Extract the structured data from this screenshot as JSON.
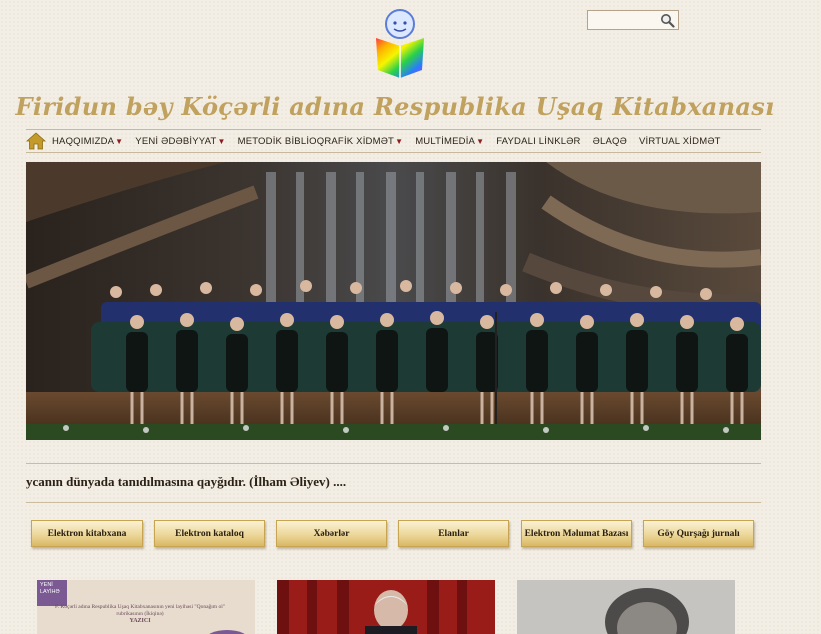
{
  "header": {
    "site_title": "Firidun bəy Köçərli adına Respublika Uşaq Kitabxanası"
  },
  "search": {
    "placeholder": "",
    "value": ""
  },
  "nav": {
    "items": [
      {
        "label": "HAQQIMIZDA",
        "has_dropdown": true
      },
      {
        "label": "YENİ ƏDƏBİYYAT",
        "has_dropdown": true
      },
      {
        "label": "METODİK BİBLİOQRAFİK XİDMƏT",
        "has_dropdown": true
      },
      {
        "label": "MULTİMEDİA",
        "has_dropdown": true
      },
      {
        "label": "FAYDALI LİNKLƏR",
        "has_dropdown": false
      },
      {
        "label": "ƏLAQƏ",
        "has_dropdown": false
      },
      {
        "label": "VİRTUAL XİDMƏT",
        "has_dropdown": false
      }
    ],
    "caret": "▼"
  },
  "marquee": {
    "text": "ycanın dünyada tanıdılmasına qayğıdır. (İlham Əliyev) ...."
  },
  "buttons": [
    {
      "label": "Elektron kitabxana"
    },
    {
      "label": "Elektron kataloq"
    },
    {
      "label": "Xəbərlər"
    },
    {
      "label": "Elanlar"
    },
    {
      "label": "Elektron Məlumat Bazası"
    },
    {
      "label": "Göy Qurşağı jurnalı"
    }
  ],
  "thumbnails": {
    "first": {
      "badge": "YENİ LAYİHƏ",
      "caption": "F. Köçərli adına Respublika Uşaq Kitabxanasının yeni layihəsi \"Qonağım ol\" rubrikasının (İkiqinə)",
      "sub": "YAZICI"
    }
  },
  "colors": {
    "background": "#f3eee5",
    "title": "#c0a15e",
    "nav_caret": "#8c1d1d",
    "button_gold": "#e6cd86"
  },
  "icons": [
    "logo-icon",
    "search-icon",
    "home-icon"
  ]
}
